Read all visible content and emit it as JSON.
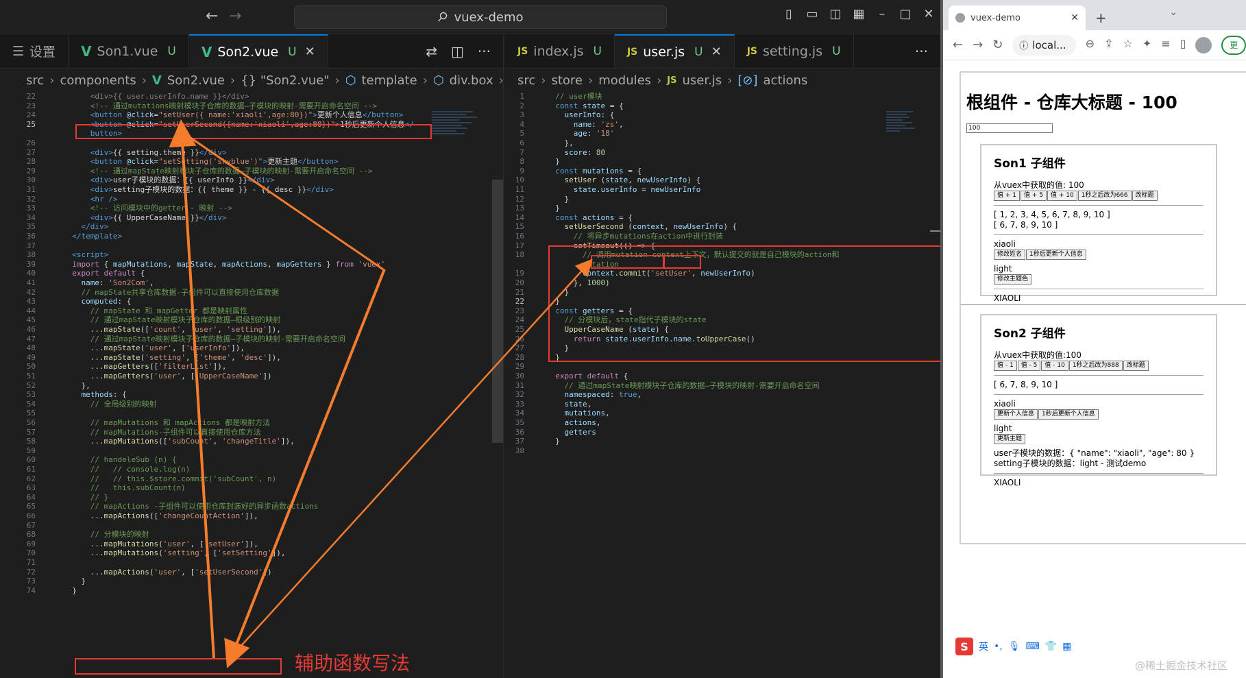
{
  "titlebar": {
    "search_text": "vuex-demo",
    "back_icon": "←",
    "forward_icon": "→"
  },
  "left_pane": {
    "tabs": [
      {
        "label": "设置",
        "icon": "settings-icon"
      },
      {
        "label": "Son1.vue",
        "badge": "U"
      },
      {
        "label": "Son2.vue",
        "badge": "U",
        "active": true
      }
    ],
    "breadcrumb": [
      "src",
      "components",
      "Son2.vue",
      "{} \"Son2.vue\"",
      "template",
      "div.box"
    ],
    "lines": [
      {
        "n": "22",
        "html": "<span class=\"c-gray\">      &lt;div&gt;{{ user.userInfo.name }}&lt;/div&gt;</span>"
      },
      {
        "n": "23",
        "html": "<span class=\"c-com\">      &lt;!-- 通过mutations映射模块子仓库的数据—子模块的映射-需要开启命名空间 --&gt;</span>"
      },
      {
        "n": "24",
        "html": "      <span class=\"c-tag\">&lt;button</span> <span class=\"c-attr\">@click</span>=<span class=\"c-str\">\"setUser({ name:'xiaoli',age:80})\"</span><span class=\"c-tag\">&gt;</span>更新个人信息<span class=\"c-tag\">&lt;/button&gt;</span>"
      },
      {
        "n": "25",
        "cur": true,
        "html": "      <span class=\"c-tag\">&lt;button</span> <span class=\"c-attr\">@click</span>=<span class=\"c-str\">\"setUserSecond({name:'xiaoli',age:80})\"</span><span class=\"c-tag\">&gt;</span>1秒后更新个人信息<span class=\"c-tag\">&lt;/</span>"
      },
      {
        "n": "",
        "html": "      <span class=\"c-tag\">button&gt;</span>"
      },
      {
        "n": "26",
        "html": ""
      },
      {
        "n": "27",
        "html": "      <span class=\"c-tag\">&lt;div&gt;</span>{{ setting.theme }}<span class=\"c-tag\">&lt;/div&gt;</span>"
      },
      {
        "n": "28",
        "html": "      <span class=\"c-tag\">&lt;button</span> <span class=\"c-attr\">@click</span>=<span class=\"c-str\">\"setSetting('skyblue')\"</span><span class=\"c-tag\">&gt;</span>更新主题<span class=\"c-tag\">&lt;/button&gt;</span>"
      },
      {
        "n": "29",
        "html": "<span class=\"c-com\">      &lt;!-- 通过mapState映射模块子仓库的数据—子模块的映射-需要开启命名空间 --&gt;</span>"
      },
      {
        "n": "30",
        "html": "      <span class=\"c-tag\">&lt;div&gt;</span>user子模块的数据：{{ userInfo }}<span class=\"c-tag\">&lt;/div&gt;</span>"
      },
      {
        "n": "31",
        "html": "      <span class=\"c-tag\">&lt;div&gt;</span>setting子模块的数据：{{ theme }} - {{ desc }}<span class=\"c-tag\">&lt;/div&gt;</span>"
      },
      {
        "n": "32",
        "html": "      <span class=\"c-tag\">&lt;hr /&gt;</span>"
      },
      {
        "n": "33",
        "html": "<span class=\"c-com\">      &lt;!-- 访问模块中的getter - 映射 --&gt;</span>"
      },
      {
        "n": "34",
        "html": "      <span class=\"c-tag\">&lt;div&gt;</span>{{ UpperCaseName }}<span class=\"c-tag\">&lt;/div&gt;</span>"
      },
      {
        "n": "35",
        "html": "    <span class=\"c-tag\">&lt;/div&gt;</span>"
      },
      {
        "n": "36",
        "html": "  <span class=\"c-tag\">&lt;/template&gt;</span>"
      },
      {
        "n": "37",
        "html": ""
      },
      {
        "n": "38",
        "html": "  <span class=\"c-tag\">&lt;script&gt;</span>"
      },
      {
        "n": "39",
        "html": "  <span class=\"c-kw\">import</span> { <span class=\"c-var\">mapMutations</span>, <span class=\"c-var\">mapState</span>, <span class=\"c-var\">mapActions</span>, <span class=\"c-var\">mapGetters</span> } <span class=\"c-kw\">from</span> <span class=\"c-str\">'vuex'</span>"
      },
      {
        "n": "40",
        "html": "  <span class=\"c-kw\">export default</span> {"
      },
      {
        "n": "41",
        "html": "    <span class=\"c-var\">name</span>: <span class=\"c-str\">'Son2Com'</span>,"
      },
      {
        "n": "42",
        "html": "<span class=\"c-com\">    // mapState共享仓库数据-子组件可以直接使用仓库数据</span>"
      },
      {
        "n": "43",
        "html": "    <span class=\"c-var\">computed</span>: {"
      },
      {
        "n": "44",
        "html": "<span class=\"c-com\">      // mapState 和 mapGetter 都是映射属性</span>"
      },
      {
        "n": "45",
        "html": "<span class=\"c-com\">      // 通过mapState映射模块子仓库的数据—根级别的映射</span>"
      },
      {
        "n": "46",
        "html": "      ...<span class=\"c-fn\">mapState</span>([<span class=\"c-str\">'count'</span>, <span class=\"c-str\">'user'</span>, <span class=\"c-str\">'setting'</span>]),"
      },
      {
        "n": "47",
        "html": "<span class=\"c-com\">      // 通过mapState映射模块子仓库的数据—子模块的映射-需要开启命名空间</span>"
      },
      {
        "n": "48",
        "html": "      ...<span class=\"c-fn\">mapState</span>(<span class=\"c-str\">'user'</span>, [<span class=\"c-str\">'userInfo'</span>]),"
      },
      {
        "n": "49",
        "html": "      ...<span class=\"c-fn\">mapState</span>(<span class=\"c-str\">'setting'</span>, [<span class=\"c-str\">'theme'</span>, <span class=\"c-str\">'desc'</span>]),"
      },
      {
        "n": "50",
        "html": "      ...<span class=\"c-fn\">mapGetters</span>([<span class=\"c-str\">'filterList'</span>]),"
      },
      {
        "n": "51",
        "html": "      ...<span class=\"c-fn\">mapGetters</span>(<span class=\"c-str\">'user'</span>, [<span class=\"c-str\">'UpperCaseName'</span>])"
      },
      {
        "n": "52",
        "html": "    },"
      },
      {
        "n": "53",
        "html": "    <span class=\"c-var\">methods</span>: {"
      },
      {
        "n": "54",
        "html": "<span class=\"c-com\">      // 全局级别的映射</span>"
      },
      {
        "n": "55",
        "html": ""
      },
      {
        "n": "56",
        "html": "<span class=\"c-com\">      // mapMutations 和 mapActions 都是映射方法</span>"
      },
      {
        "n": "57",
        "html": "<span class=\"c-com\">      // mapMutations-子组件可以直接使用仓库方法</span>"
      },
      {
        "n": "58",
        "html": "      ...<span class=\"c-fn\">mapMutations</span>([<span class=\"c-str\">'subCount'</span>, <span class=\"c-str\">'changeTitle'</span>]),"
      },
      {
        "n": "59",
        "html": ""
      },
      {
        "n": "60",
        "html": "<span class=\"c-com\">      // handeleSub (n) {</span>"
      },
      {
        "n": "61",
        "html": "<span class=\"c-com\">      //   // console.log(n)</span>"
      },
      {
        "n": "62",
        "html": "<span class=\"c-com\">      //   // this.$store.commit('subCount', n)</span>"
      },
      {
        "n": "63",
        "html": "<span class=\"c-com\">      //   this.subCount(n)</span>"
      },
      {
        "n": "64",
        "html": "<span class=\"c-com\">      // }</span>"
      },
      {
        "n": "65",
        "html": "<span class=\"c-com\">      // mapActions -子组件可以使用仓库封装好的异步函数actions</span>"
      },
      {
        "n": "66",
        "html": "      ...<span class=\"c-fn\">mapActions</span>([<span class=\"c-str\">'changeCountAction'</span>]),"
      },
      {
        "n": "67",
        "html": ""
      },
      {
        "n": "68",
        "html": "<span class=\"c-com\">      // 分模块的映射</span>"
      },
      {
        "n": "69",
        "html": "      ...<span class=\"c-fn\">mapMutations</span>(<span class=\"c-str\">'user'</span>, [<span class=\"c-str\">'setUser'</span>]),"
      },
      {
        "n": "70",
        "html": "      ...<span class=\"c-fn\">mapMutations</span>(<span class=\"c-str\">'setting'</span>, [<span class=\"c-str\">'setSetting'</span>]),"
      },
      {
        "n": "71",
        "html": ""
      },
      {
        "n": "72",
        "html": "      ...<span class=\"c-fn\">mapActions</span>(<span class=\"c-str\">'user'</span>, [<span class=\"c-str\">'setUserSecond'</span>])"
      },
      {
        "n": "73",
        "html": "    }"
      },
      {
        "n": "74",
        "html": "  }"
      }
    ],
    "annotation": "辅助函数写法"
  },
  "right_pane": {
    "tabs": [
      {
        "label": "index.js",
        "badge": "U"
      },
      {
        "label": "user.js",
        "badge": "U",
        "active": true
      },
      {
        "label": "setting.js",
        "badge": "U"
      }
    ],
    "breadcrumb": [
      "src",
      "store",
      "modules",
      "user.js",
      "actions"
    ],
    "lines": [
      {
        "n": "1",
        "html": "<span class=\"c-com\">  // user模块</span>"
      },
      {
        "n": "2",
        "html": "  <span class=\"c-tag\">const</span> <span class=\"c-var\">state</span> = {"
      },
      {
        "n": "3",
        "html": "    <span class=\"c-var\">userInfo</span>: {"
      },
      {
        "n": "4",
        "html": "      <span class=\"c-var\">name</span>: <span class=\"c-str\">'zs'</span>,"
      },
      {
        "n": "5",
        "html": "      <span class=\"c-var\">age</span>: <span class=\"c-str\">'18'</span>"
      },
      {
        "n": "6",
        "html": "    },"
      },
      {
        "n": "7",
        "html": "    <span class=\"c-var\">score</span>: <span class=\"c-num\">80</span>"
      },
      {
        "n": "8",
        "html": "  }"
      },
      {
        "n": "9",
        "html": "  <span class=\"c-tag\">const</span> <span class=\"c-var\">mutations</span> = {"
      },
      {
        "n": "10",
        "html": "    <span class=\"c-fn\">setUser</span> (<span class=\"c-var\">state</span>, <span class=\"c-var\">newUserInfo</span>) {"
      },
      {
        "n": "11",
        "html": "      <span class=\"c-var\">state</span>.<span class=\"c-var\">userInfo</span> = <span class=\"c-var\">newUserInfo</span>"
      },
      {
        "n": "12",
        "html": "    }"
      },
      {
        "n": "13",
        "html": "  }"
      },
      {
        "n": "14",
        "html": "  <span class=\"c-tag\">const</span> <span class=\"c-var\">actions</span> = {"
      },
      {
        "n": "15",
        "html": "    <span class=\"c-fn\">setUserSecond</span> (<span class=\"c-var\">context</span>, <span class=\"c-var\">newUserInfo</span>) {"
      },
      {
        "n": "16",
        "html": "<span class=\"c-com\">      // 将异步mutations在action中进行封装</span>"
      },
      {
        "n": "17",
        "html": "      <span class=\"c-fn\">setTimeout</span>(() =&gt; {"
      },
      {
        "n": "18",
        "html": "<span class=\"c-com\">        // 调用mutation context上下文，默认提交的就是自己模块的action和</span>"
      },
      {
        "n": "",
        "html": "<span class=\"c-com\">        mutation</span>"
      },
      {
        "n": "19",
        "html": "        <span class=\"c-var\">context</span>.<span class=\"c-fn\">commit</span>(<span class=\"c-str\">'setUser'</span>, <span class=\"c-var\">newUserInfo</span>)"
      },
      {
        "n": "20",
        "html": "      }, <span class=\"c-num\">1000</span>)"
      },
      {
        "n": "21",
        "html": "    }"
      },
      {
        "n": "22",
        "cur": true,
        "html": "  }"
      },
      {
        "n": "23",
        "html": "  <span class=\"c-tag\">const</span> <span class=\"c-var\">getters</span> = {"
      },
      {
        "n": "24",
        "html": "<span class=\"c-com\">    // 分模块后，state指代子模块的state</span>"
      },
      {
        "n": "25",
        "html": "    <span class=\"c-fn\">UpperCaseName</span> (<span class=\"c-var\">state</span>) {"
      },
      {
        "n": "26",
        "html": "      <span class=\"c-kw\">return</span> <span class=\"c-var\">state</span>.<span class=\"c-var\">userInfo</span>.<span class=\"c-var\">name</span>.<span class=\"c-fn\">toUpperCase</span>()"
      },
      {
        "n": "27",
        "html": "    }"
      },
      {
        "n": "28",
        "html": "  }"
      },
      {
        "n": "29",
        "html": ""
      },
      {
        "n": "30",
        "html": "  <span class=\"c-kw\">export default</span> {"
      },
      {
        "n": "31",
        "html": "<span class=\"c-com\">    // 通过mapState映射模块子仓库的数据—子模块的映射-需要开启命名空间</span>"
      },
      {
        "n": "32",
        "html": "    <span class=\"c-var\">namespaced</span>: <span class=\"c-tag\">true</span>,"
      },
      {
        "n": "33",
        "html": "    <span class=\"c-var\">state</span>,"
      },
      {
        "n": "34",
        "html": "    <span class=\"c-var\">mutations</span>,"
      },
      {
        "n": "35",
        "html": "    <span class=\"c-var\">actions</span>,"
      },
      {
        "n": "36",
        "html": "    <span class=\"c-var\">getters</span>"
      },
      {
        "n": "37",
        "html": "  }"
      },
      {
        "n": "38",
        "html": ""
      }
    ]
  },
  "browser": {
    "tab_title": "vuex-demo",
    "address": "local...",
    "update_label": "更",
    "page": {
      "title": "根组件 - 仓库大标题 - 100",
      "input_value": "100",
      "son1": {
        "title": "Son1 子组件",
        "value_line": "从vuex中获取的值: 100",
        "buttons": [
          "值 + 1",
          "值 + 5",
          "值 + 10",
          "1秒之后改为666",
          "改标题"
        ],
        "list1": "[ 1, 2, 3, 4, 5, 6, 7, 8, 9, 10 ]",
        "list2": "[ 6, 7, 8, 9, 10 ]",
        "name": "xiaoli",
        "name_buttons": [
          "修改姓名",
          "1秒后更新个人信息"
        ],
        "theme": "light",
        "theme_button": "修改主题色",
        "upper": "XIAOLI"
      },
      "son2": {
        "title": "Son2 子组件",
        "value_line": "从vuex中获取的值:100",
        "buttons": [
          "值 - 1",
          "值 - 5",
          "值 - 10",
          "1秒之后改为888",
          "改标题"
        ],
        "list": "[ 6, 7, 8, 9, 10 ]",
        "name": "xiaoli",
        "name_buttons": [
          "更新个人信息",
          "1秒后更新个人信息"
        ],
        "theme": "light",
        "theme_button": "更新主题",
        "user_data": "user子模块的数据：{ \"name\": \"xiaoli\", \"age\": 80 }",
        "setting_data": "setting子模块的数据：light - 测试demo",
        "upper": "XIAOLI"
      }
    }
  },
  "ime": {
    "label": "英"
  },
  "watermark": "@稀土掘金技术社区"
}
